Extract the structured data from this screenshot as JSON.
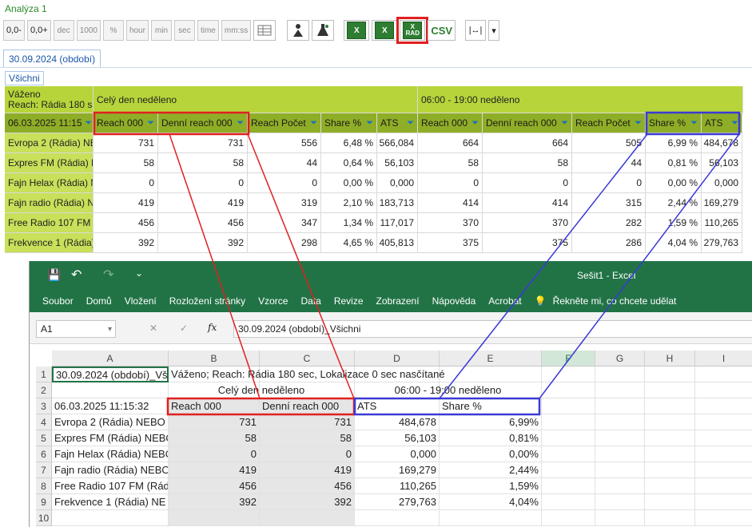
{
  "app": {
    "title": "Analýza 1"
  },
  "toolbar": {
    "buttons": [
      "0,0-",
      "0,0+",
      "dec",
      "1000",
      "%",
      "hour",
      "min",
      "sec",
      "time",
      "mm:ss"
    ],
    "export": {
      "xl1": "X",
      "xl2": "X",
      "xl_rad": "RAD",
      "csv": "CSV"
    },
    "width_symbol": "|↔|",
    "dropdown_symbol": "▾"
  },
  "tabs": {
    "period": "30.09.2024 (období)",
    "sub": "Všichni"
  },
  "report": {
    "corner_line1": "Váženo",
    "corner_line2": "Reach: Rádia 180 sec",
    "group1": "Celý den neděleno",
    "group2": "06:00 - 19:00 neděleno",
    "date_header": "06.03.2025 11:15",
    "columns": [
      "Reach 000",
      "Denní reach 000",
      "Reach Počet",
      "Share %",
      "ATS",
      "Reach 000",
      "Denní reach 000",
      "Reach Počet",
      "Share %",
      "ATS"
    ],
    "filter_icon": "⏷",
    "rows": [
      {
        "label": "Evropa 2 (Rádia) NE",
        "values": [
          "731",
          "731",
          "556",
          "6,48 %",
          "566,084",
          "664",
          "664",
          "505",
          "6,99 %",
          "484,678"
        ]
      },
      {
        "label": "Expres FM (Rádia) N",
        "values": [
          "58",
          "58",
          "44",
          "0,64 %",
          "56,103",
          "58",
          "58",
          "44",
          "0,81 %",
          "56,103"
        ]
      },
      {
        "label": "Fajn Helax (Rádia) N",
        "values": [
          "0",
          "0",
          "0",
          "0,00 %",
          "0,000",
          "0",
          "0",
          "0",
          "0,00 %",
          "0,000"
        ]
      },
      {
        "label": "Fajn radio (Rádia) N",
        "values": [
          "419",
          "419",
          "319",
          "2,10 %",
          "183,713",
          "414",
          "414",
          "315",
          "2,44 %",
          "169,279"
        ]
      },
      {
        "label": "Free Radio 107 FM",
        "values": [
          "456",
          "456",
          "347",
          "1,34 %",
          "117,017",
          "370",
          "370",
          "282",
          "1,59 %",
          "110,265"
        ]
      },
      {
        "label": "Frekvence 1 (Rádia)",
        "values": [
          "392",
          "392",
          "298",
          "4,65 %",
          "405,813",
          "375",
          "375",
          "286",
          "4,04 %",
          "279,763"
        ]
      }
    ]
  },
  "excel": {
    "window_title": "Sešit1  -  Excel",
    "qat": {
      "save": "💾",
      "undo": "↶",
      "redo": "↷",
      "more": "⌄"
    },
    "ribbon": [
      "Soubor",
      "Domů",
      "Vložení",
      "Rozložení stránky",
      "Vzorce",
      "Data",
      "Revize",
      "Zobrazení",
      "Nápověda",
      "Acrobat",
      "Řekněte mi, co chcete udělat"
    ],
    "tell_icon": "💡",
    "namebox": "A1",
    "formula_buttons": {
      "cancel": "✕",
      "enter": "✓",
      "fx": "fx"
    },
    "formula": "30.09.2024 (období)_Všichni",
    "col_headers": [
      "A",
      "B",
      "C",
      "D",
      "E",
      "F",
      "G",
      "H",
      "I"
    ],
    "row_headers": [
      "1",
      "2",
      "3",
      "4",
      "5",
      "6",
      "7",
      "8",
      "9",
      "10"
    ],
    "r1": {
      "a": "30.09.2024 (období)_Vš",
      "b": "Váženo; Reach: Rádia 180 sec, Lokalizace 0 sec nasčítané"
    },
    "r2": {
      "bc": "Celý den neděleno",
      "de": "06:00 - 19:00 neděleno"
    },
    "r3": {
      "a": "06.03.2025 11:15:32",
      "b": "Reach 000",
      "c": "Denní reach 000",
      "d": "ATS",
      "e": "Share %"
    },
    "data_rows": [
      {
        "a": "Evropa 2 (Rádia) NEBO",
        "b": "731",
        "c": "731",
        "d": "484,678",
        "e": "6,99%"
      },
      {
        "a": "Expres FM (Rádia) NEBO",
        "b": "58",
        "c": "58",
        "d": "56,103",
        "e": "0,81%"
      },
      {
        "a": "Fajn Helax (Rádia) NEBO",
        "b": "0",
        "c": "0",
        "d": "0,000",
        "e": "0,00%"
      },
      {
        "a": "Fajn radio (Rádia) NEBO",
        "b": "419",
        "c": "419",
        "d": "169,279",
        "e": "2,44%"
      },
      {
        "a": "Free Radio 107 FM (Rád",
        "b": "456",
        "c": "456",
        "d": "110,265",
        "e": "1,59%"
      },
      {
        "a": "Frekvence 1 (Rádia) NE",
        "b": "392",
        "c": "392",
        "d": "279,763",
        "e": "4,04%"
      }
    ]
  },
  "colors": {
    "green_header": "#b7d53a",
    "green_dark": "#8fae27",
    "excel_green": "#217346",
    "highlight_red": "#e02020",
    "highlight_blue": "#3a3ad6"
  }
}
